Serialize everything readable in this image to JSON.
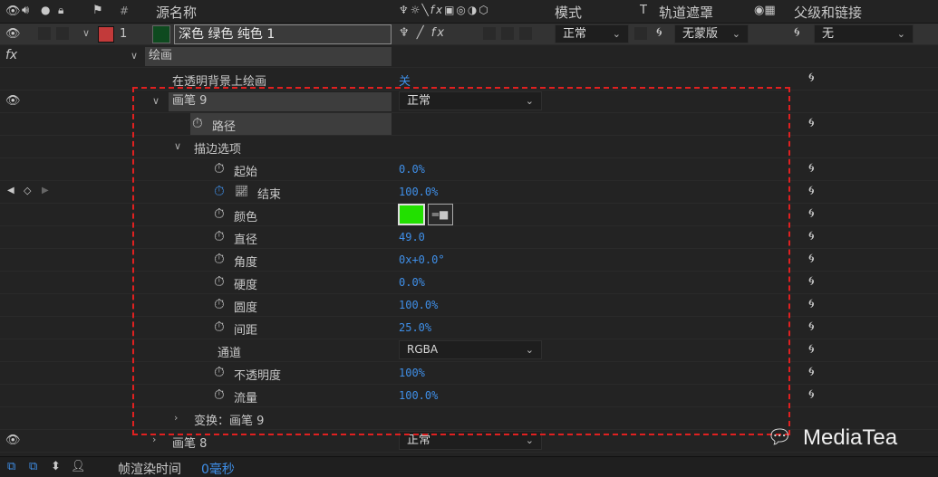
{
  "header": {
    "hash": "#",
    "source_name": "源名称",
    "mode": "模式",
    "t": "T",
    "track_matte": "轨道遮罩",
    "parent_link": "父级和链接"
  },
  "layer": {
    "number": "1",
    "name": "深色 绿色 纯色 1",
    "mode": "正常",
    "matte": "无蒙版",
    "parent": "无",
    "label_color": "#c23a3a",
    "thumb_color": "#0e4a1f"
  },
  "effects": {
    "fx_label": "fx",
    "paint_label": "绘画",
    "paint_on_transparent_label": "在透明背景上绘画",
    "paint_on_transparent_value": "关"
  },
  "brush": {
    "label": "画笔 9",
    "mode": "正常",
    "path_label": "路径",
    "stroke_options_label": "描边选项",
    "props": [
      {
        "label": "起始",
        "value": "0.0%"
      },
      {
        "label": "结束",
        "value": "100.0%"
      },
      {
        "label": "颜色",
        "value": ""
      },
      {
        "label": "直径",
        "value": "49.0"
      },
      {
        "label": "角度",
        "value": "0x+0.0°"
      },
      {
        "label": "硬度",
        "value": "0.0%"
      },
      {
        "label": "圆度",
        "value": "100.0%"
      },
      {
        "label": "间距",
        "value": "25.0%"
      }
    ],
    "channel_label": "通道",
    "channel_value": "RGBA",
    "opacity_label": "不透明度",
    "opacity_value": "100%",
    "flow_label": "流量",
    "flow_value": "100.0%",
    "transform_label": "变换：画笔 9",
    "stroke_color": "#22e000"
  },
  "brush8": {
    "label": "画笔 8",
    "mode": "正常"
  },
  "footer": {
    "render_label": "帧渲染时间",
    "render_value": "0毫秒"
  },
  "watermark": "MediaTea",
  "colors": {
    "annotation": "#e02020",
    "accent": "#3f8fe8"
  }
}
